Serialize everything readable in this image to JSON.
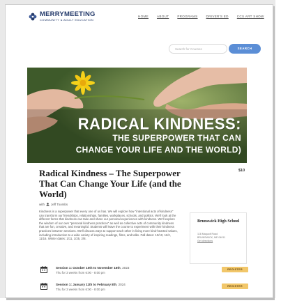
{
  "brand": {
    "name": "MERRYMEETING",
    "tagline": "COMMUNITY & ADULT EDUCATION",
    "logo_icon": "flower-logo-icon"
  },
  "nav": {
    "items": [
      {
        "label": "HOME"
      },
      {
        "label": "ABOUT"
      },
      {
        "label": "PROGRAMS"
      },
      {
        "label": "DRIVER'S ED"
      },
      {
        "label": "CCS ART SHOW"
      }
    ]
  },
  "search": {
    "placeholder": "Search for Courses",
    "button_label": "SEARCH"
  },
  "hero": {
    "line1": "RADICAL KINDNESS:",
    "line2": "THE SUPERPOWER THAT CAN",
    "line3": "CHANGE YOUR LIFE AND THE WORLD)"
  },
  "course": {
    "title": "Radical Kindness – The Superpower That Can Change Your Life (and the World)",
    "price": "$10",
    "byline_prefix": "with",
    "instructor": "Jeff Toombs",
    "description": "Kindness is a superpower that every one of us has. We will explore how \"intentional acts of kindness\" can transform our friendships, relationships, families, workplaces, schools, and politics. We'll look at the different forms that kindness can take and share our personal experiences with kindness. We'll explore the wisdom of our own \"personal kindness practices\" as well as collective acts of community kindness that are fun, creative, and meaningful. Students will leave the course to experiment with their kindness practices between sessions. We'll discuss ways to support each other in living more kind-hearted values, including introduction to a wide variety of inspiring readings, films, and talks. Fall dates: 10/10, 11/2, 11/16. Winter dates: 1/11, 1/25, 2/8."
  },
  "venue": {
    "name": "Brunswick High School",
    "address_line1": "116 Maquoit Road",
    "address_line2": "BRUNSWICK, ME 04011",
    "link": "Get directions"
  },
  "sessions": [
    {
      "title": "Session 1: October 10th to November 16th",
      "year": "2023",
      "time": "Thu for 3 weeks from 6:00 - 8:00 pm",
      "button": "REGISTER"
    },
    {
      "title": "Session 1: January 11th to February 8th",
      "year": "2024",
      "time": "Thu for 3 weeks from 6:00 - 8:00 pm",
      "button": "REGISTER"
    }
  ],
  "colors": {
    "brand": "#243a6b",
    "search_button": "#5b8ed6",
    "register_button": "#f2c76a"
  }
}
